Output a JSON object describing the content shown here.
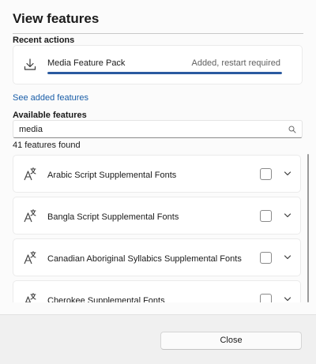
{
  "dialog": {
    "title": "View features"
  },
  "recent": {
    "heading": "Recent actions",
    "item": {
      "name": "Media Feature Pack",
      "status": "Added, restart required",
      "icon": "download-icon",
      "progress": 1.0
    }
  },
  "links": {
    "see_added": "See added features"
  },
  "available": {
    "heading": "Available features",
    "search_value": "media",
    "count_text": "41 features found",
    "items": [
      {
        "label": "Arabic Script Supplemental Fonts",
        "checked": false
      },
      {
        "label": "Bangla Script Supplemental Fonts",
        "checked": false
      },
      {
        "label": "Canadian Aboriginal Syllabics Supplemental Fonts",
        "checked": false
      },
      {
        "label": "Cherokee Supplemental Fonts",
        "checked": false
      }
    ]
  },
  "footer": {
    "close_label": "Close"
  },
  "colors": {
    "accent": "#2a5aa0",
    "link": "#1a5ea8"
  }
}
